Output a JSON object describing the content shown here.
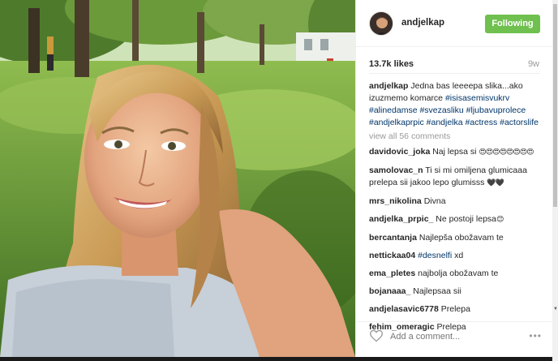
{
  "post": {
    "username": "andjelkap",
    "follow_label": "Following",
    "likes": "13.7k likes",
    "age": "9w"
  },
  "caption": {
    "username": "andjelkap",
    "text": " Jedna bas leeeepa slika...ako izuzmemo komarce ",
    "tags": [
      "#isisasemisvukrv",
      "#alinedamse",
      "#svezasliku",
      "#ljubavuprolece",
      "#andjelkaprpic",
      "#andjelka",
      "#actress",
      "#actorslife"
    ]
  },
  "view_all": "view all 56 comments",
  "comments": [
    {
      "username": "davidovic_joka",
      "text": " Naj lepsa si",
      "emoji": "😍😍😍😍😍😍😍😍"
    },
    {
      "username": "samolovac_n",
      "text": " Ti si mi omiljena glumicaaa prelepa sii jakoo lepo glumisss ",
      "emoji": "🖤🖤"
    },
    {
      "username": "mrs_nikolina",
      "text": " Divna",
      "emoji": ""
    },
    {
      "username": "andjelka_prpic_",
      "text": " Ne postoji lepsa",
      "emoji": "😊"
    },
    {
      "username": "bercantanja",
      "text": " Najlepša obožavam te",
      "emoji": ""
    },
    {
      "username": "nettickaa04",
      "text": " ",
      "tag": "#desnelfi",
      "after": " xd",
      "emoji": ""
    },
    {
      "username": "ema_pletes",
      "text": " najbolja obožavam te",
      "emoji": ""
    },
    {
      "username": "bojanaaa_",
      "text": " Najlepsaa sii",
      "emoji": ""
    },
    {
      "username": "andjelasavic6778",
      "text": " Prelepa",
      "emoji": ""
    },
    {
      "username": "fehim_omeragic",
      "text": " Prelepa",
      "emoji": ""
    }
  ],
  "footer": {
    "add_comment_placeholder": "Add a comment...",
    "more_label": "•••"
  }
}
